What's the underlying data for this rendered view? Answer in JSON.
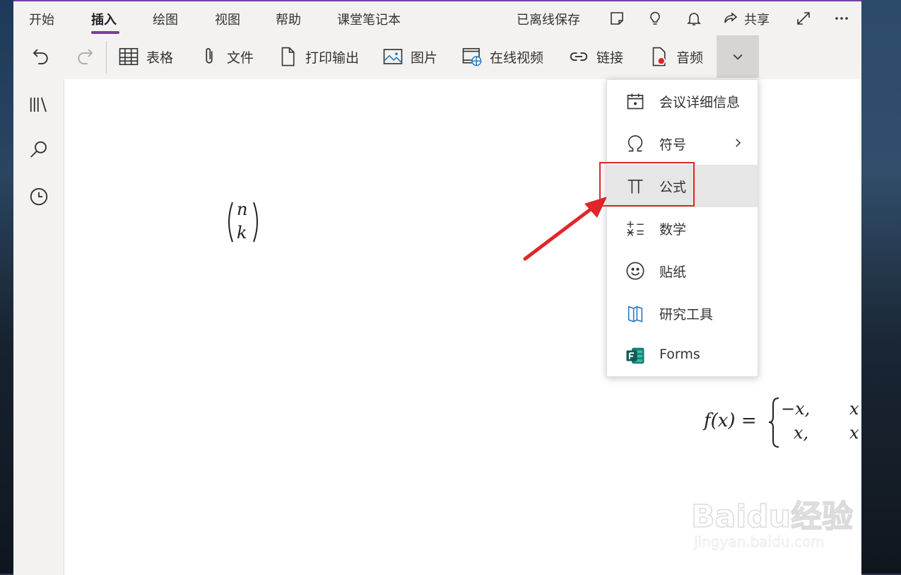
{
  "tabs": [
    {
      "label": "开始"
    },
    {
      "label": "插入"
    },
    {
      "label": "绘图"
    },
    {
      "label": "视图"
    },
    {
      "label": "帮助"
    },
    {
      "label": "课堂笔记本"
    }
  ],
  "active_tab": "插入",
  "status": {
    "offline_label": "已离线保存"
  },
  "share": {
    "label": "共享"
  },
  "toolbar": {
    "table_label": "表格",
    "file_label": "文件",
    "printout_label": "打印输出",
    "picture_label": "图片",
    "online_video_label": "在线视频",
    "link_label": "链接",
    "audio_label": "音频"
  },
  "menu": {
    "items": [
      {
        "label": "会议详细信息",
        "icon": "calendar-icon"
      },
      {
        "label": "符号",
        "icon": "omega-icon",
        "has_submenu": true
      },
      {
        "label": "公式",
        "icon": "pi-icon",
        "highlighted": true
      },
      {
        "label": "数学",
        "icon": "math-icon"
      },
      {
        "label": "贴纸",
        "icon": "smiley-icon"
      },
      {
        "label": "研究工具",
        "icon": "researcher-icon"
      },
      {
        "label": "Forms",
        "icon": "forms-icon"
      }
    ]
  },
  "canvas": {
    "binom": {
      "top": "n",
      "bottom": "k"
    },
    "piecewise": {
      "lhs": "f(x) =",
      "case1": "−x,",
      "case2": "x,",
      "cond1": "x",
      "cond2": "x"
    }
  },
  "watermark": {
    "brand": "Baidu经验",
    "url": "jingyan.baidu.com"
  },
  "colors": {
    "accent": "#7a3fa0",
    "highlight_box": "#e0262a",
    "arrow": "#e0262a"
  }
}
